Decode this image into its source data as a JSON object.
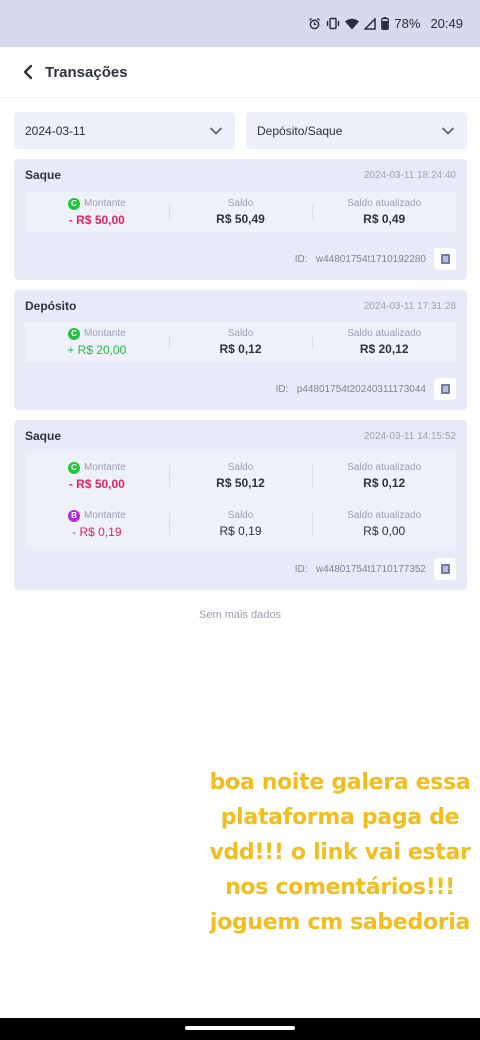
{
  "status_bar": {
    "battery": "78%",
    "time": "20:49"
  },
  "header": {
    "title": "Transações",
    "back_icon": "chevron-left-icon"
  },
  "filters": {
    "date": "2024-03-11",
    "type": "Depósito/Saque"
  },
  "labels": {
    "amount": "Montante",
    "balance": "Saldo",
    "updated_balance": "Saldo atualizado",
    "id": "ID:"
  },
  "transactions": [
    {
      "type": "Saque",
      "datetime": "2024-03-11 18:24:40",
      "rows": [
        {
          "badge": "C",
          "amount": "- R$ 50,00",
          "balance": "R$ 50,49",
          "updated": "R$ 0,49"
        }
      ],
      "id": "w44801754t1710192280"
    },
    {
      "type": "Depósito",
      "datetime": "2024-03-11 17:31:28",
      "rows": [
        {
          "badge": "C",
          "amount": "+ R$ 20,00",
          "balance": "R$ 0,12",
          "updated": "R$ 20,12"
        }
      ],
      "id": "p44801754t20240311173044"
    },
    {
      "type": "Saque",
      "datetime": "2024-03-11 14:15:52",
      "rows": [
        {
          "badge": "C",
          "amount": "- R$ 50,00",
          "balance": "R$ 50,12",
          "updated": "R$ 0,12"
        },
        {
          "badge": "B",
          "amount": "- R$ 0,19",
          "balance": "R$ 0,19",
          "updated": "R$ 0,00"
        }
      ],
      "id": "w44801754t1710177352"
    }
  ],
  "footer": {
    "no_more": "Sem mais dados"
  },
  "overlay_text": [
    "boa noite galera essa",
    "plataforma paga de",
    "vdd!!! o link vai estar",
    "nos comentários!!!",
    "joguem cm sabedoria"
  ],
  "colors": {
    "negative": "#e0265b",
    "positive": "#22b845",
    "overlay": "#f1bd1f",
    "badge_c": "#24c33c",
    "badge_b": "#b02ad6"
  }
}
